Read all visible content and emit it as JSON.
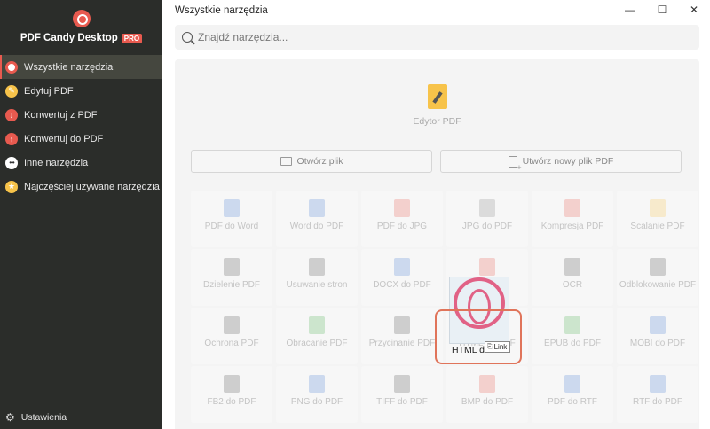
{
  "app": {
    "name": "PDF Candy Desktop",
    "badge": "PRO"
  },
  "sidebar": {
    "items": [
      {
        "label": "Wszystkie narzędzia",
        "icon": "target-icon",
        "active": true
      },
      {
        "label": "Edytuj PDF",
        "icon": "pencil-icon",
        "active": false
      },
      {
        "label": "Konwertuj z PDF",
        "icon": "arrow-down-icon",
        "active": false
      },
      {
        "label": "Konwertuj do PDF",
        "icon": "arrow-up-icon",
        "active": false
      },
      {
        "label": "Inne narzędzia",
        "icon": "dots-icon",
        "active": false
      },
      {
        "label": "Najczęściej używane narzędzia",
        "icon": "star-icon",
        "active": false
      }
    ],
    "settings_label": "Ustawienia",
    "settings_icon": "gear-icon"
  },
  "window": {
    "title": "Wszystkie narzędzia",
    "minimize_icon": "minimize-icon",
    "maximize_icon": "maximize-icon",
    "close_icon": "close-icon"
  },
  "search": {
    "placeholder": "Znajdź narzędzia...",
    "value": ""
  },
  "editor": {
    "label": "Edytor PDF",
    "open_label": "Otwórz plik",
    "new_label": "Utwórz nowy plik PDF"
  },
  "tools": [
    {
      "label": "PDF do Word",
      "color": "#4a7fd4"
    },
    {
      "label": "Word do PDF",
      "color": "#4a7fd4"
    },
    {
      "label": "PDF do JPG",
      "color": "#e85a4f"
    },
    {
      "label": "JPG do PDF",
      "color": "#888888"
    },
    {
      "label": "Kompresja PDF",
      "color": "#e85a4f"
    },
    {
      "label": "Scalanie PDF",
      "color": "#f7c34a"
    },
    {
      "label": "Dzielenie PDF",
      "color": "#555555"
    },
    {
      "label": "Usuwanie stron",
      "color": "#555555"
    },
    {
      "label": "DOCX do PDF",
      "color": "#4a7fd4"
    },
    {
      "label": "",
      "color": "#e85a4f"
    },
    {
      "label": "OCR",
      "color": "#555555"
    },
    {
      "label": "Odblokowanie PDF",
      "color": "#555555"
    },
    {
      "label": "Ochrona PDF",
      "color": "#555555"
    },
    {
      "label": "Obracanie PDF",
      "color": "#4caf50"
    },
    {
      "label": "Przycinanie PDF",
      "color": "#555555"
    },
    {
      "label": "HTML do PDF",
      "color": "#4a7fd4"
    },
    {
      "label": "EPUB do PDF",
      "color": "#4caf50"
    },
    {
      "label": "MOBI do PDF",
      "color": "#4a7fd4"
    },
    {
      "label": "FB2 do PDF",
      "color": "#555555"
    },
    {
      "label": "PNG do PDF",
      "color": "#4a7fd4"
    },
    {
      "label": "TIFF do PDF",
      "color": "#555555"
    },
    {
      "label": "BMP do PDF",
      "color": "#e85a4f"
    },
    {
      "label": "PDF do RTF",
      "color": "#4a7fd4"
    },
    {
      "label": "RTF do PDF",
      "color": "#4a7fd4"
    }
  ],
  "drag": {
    "label": "HTML do",
    "tooltip": "Link"
  }
}
